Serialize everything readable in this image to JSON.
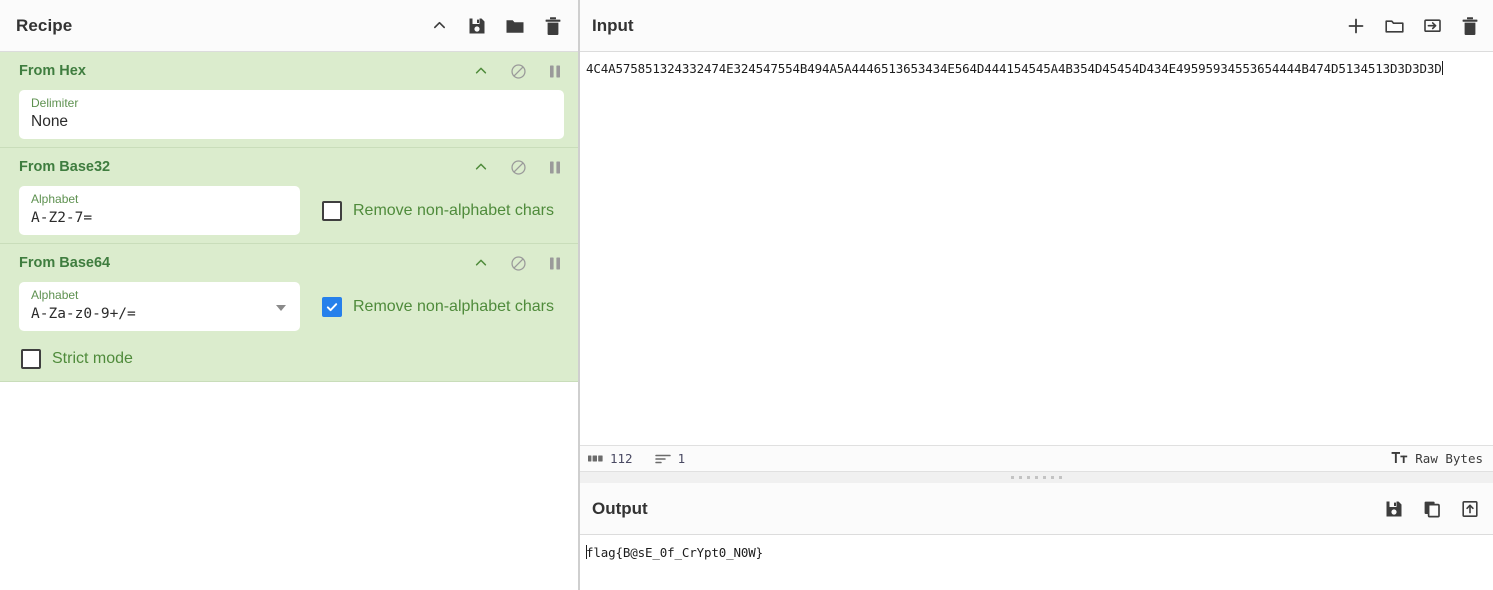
{
  "recipe": {
    "title": "Recipe",
    "header_icons": [
      {
        "name": "collapse-chevron-icon",
        "label": "chevron-up-icon"
      },
      {
        "name": "save-recipe-icon",
        "label": "floppy-save-icon"
      },
      {
        "name": "load-recipe-icon",
        "label": "folder-icon"
      },
      {
        "name": "clear-recipe-icon",
        "label": "trash-icon"
      }
    ],
    "operations": [
      {
        "title": "From Hex",
        "args": [
          {
            "label": "Delimiter",
            "value": "None",
            "type": "text"
          }
        ],
        "checkboxes": []
      },
      {
        "title": "From Base32",
        "args": [
          {
            "label": "Alphabet",
            "value": "A-Z2-7=",
            "type": "text"
          }
        ],
        "checkboxes": [
          {
            "label": "Remove non-alphabet chars",
            "checked": false
          }
        ]
      },
      {
        "title": "From Base64",
        "args": [
          {
            "label": "Alphabet",
            "value": "A-Za-z0-9+/=",
            "type": "select"
          }
        ],
        "checkboxes": [
          {
            "label": "Remove non-alphabet chars",
            "checked": true
          },
          {
            "label": "Strict mode",
            "checked": false
          }
        ]
      }
    ]
  },
  "input": {
    "title": "Input",
    "value": "4C4A575851324332474E324547554B494A5A4446513653434E564D444154545A4B354D45454D434E49595934553654444B474D5134513D3D3D3D",
    "header_icons": [
      {
        "name": "add-input-tab-icon",
        "label": "plus-icon"
      },
      {
        "name": "open-folder-as-input-icon",
        "label": "folder-open-icon"
      },
      {
        "name": "open-file-as-input-icon",
        "label": "import-file-icon"
      },
      {
        "name": "clear-input-icon",
        "label": "trash-icon"
      }
    ],
    "status": {
      "length_label": "112",
      "lines_label": "1",
      "encoding_label": "Raw Bytes"
    }
  },
  "output": {
    "title": "Output",
    "value": "flag{B@sE_0f_CrYpt0_N0W}",
    "header_icons": [
      {
        "name": "save-output-icon",
        "label": "floppy-save-icon"
      },
      {
        "name": "copy-output-icon",
        "label": "copy-icon"
      },
      {
        "name": "replace-input-with-output-icon",
        "label": "move-to-input-icon"
      }
    ]
  },
  "colors": {
    "operation_bg": "#dbeccd",
    "operation_title": "#3f7d3f",
    "checkbox_checked": "#2680eb",
    "panel_header_bg": "#fbfbfb"
  }
}
